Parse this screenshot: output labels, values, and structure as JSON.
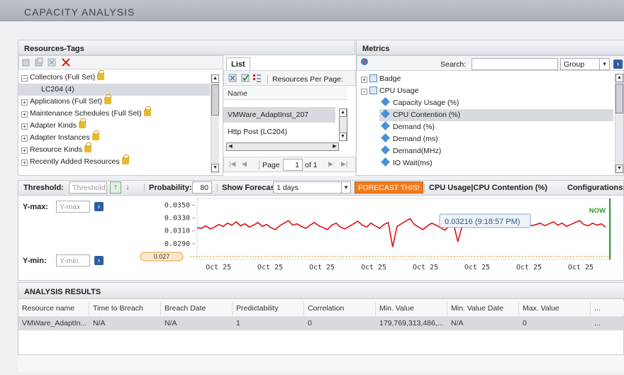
{
  "app": {
    "title": "CAPACITY ANALYSIS"
  },
  "resources": {
    "header": "Resources-Tags",
    "tree": [
      {
        "label": "Collectors (Full Set)",
        "expand": "minus",
        "lock": true,
        "indent": 0
      },
      {
        "label": "LC204 (4)",
        "expand": "",
        "lock": false,
        "indent": 1,
        "selected": true
      },
      {
        "label": "Applications (Full Set)",
        "expand": "plus",
        "lock": true,
        "indent": 0
      },
      {
        "label": "Maintenance Schedules (Full Set)",
        "expand": "plus",
        "lock": true,
        "indent": 0
      },
      {
        "label": "Adapter Kinds",
        "expand": "plus",
        "lock": true,
        "indent": 0
      },
      {
        "label": "Adapter Instances",
        "expand": "plus",
        "lock": true,
        "indent": 0
      },
      {
        "label": "Resource Kinds",
        "expand": "plus",
        "lock": true,
        "indent": 0
      },
      {
        "label": "Recently Added Resources",
        "expand": "plus",
        "lock": true,
        "indent": 0
      }
    ]
  },
  "list": {
    "tab": "List",
    "resources_per_page": "Resources Per Page:",
    "column": "Name",
    "rows": [
      "VMWare_AdaptInst_207",
      "Http Post (LC204)"
    ],
    "page_label": "Page",
    "page_value": "1",
    "of_label": "of 1"
  },
  "metrics": {
    "header": "Metrics",
    "search_label": "Search:",
    "search_value": "",
    "group_value": "Group",
    "items": [
      {
        "label": "Badge",
        "type": "group",
        "expand": "plus",
        "indent": 0
      },
      {
        "label": "CPU Usage",
        "type": "group",
        "expand": "minus",
        "indent": 0
      },
      {
        "label": "Capacity Usage (%)",
        "type": "metric",
        "indent": 1
      },
      {
        "label": "CPU Contention (%)",
        "type": "metric",
        "indent": 1,
        "selected": true
      },
      {
        "label": "Demand (%)",
        "type": "metric",
        "indent": 1
      },
      {
        "label": "Demand (ms)",
        "type": "metric",
        "indent": 1
      },
      {
        "label": "Demand(MHz)",
        "type": "metric",
        "indent": 1
      },
      {
        "label": "IO Wait(ms)",
        "type": "metric",
        "indent": 1
      }
    ]
  },
  "toolbar": {
    "threshold_label": "Threshold:",
    "threshold_placeholder": "Threshold",
    "probability_label": "Probability:",
    "probability_value": "80",
    "forecast_label": "Show Forecast:",
    "forecast_value": "1 days",
    "forecast_button": "FORECAST THIS!",
    "metric_title": "CPU Usage|CPU Contention (%)",
    "configurations": "Configurations:"
  },
  "chart_controls": {
    "ymax_label": "Y-max:",
    "ymax_placeholder": "Y-max",
    "ymin_label": "Y-min:",
    "ymin_placeholder": "Y-min",
    "threshold_badge": "0.027"
  },
  "chart_data": {
    "type": "line",
    "y_ticks": [
      "0.0350",
      "0.0330",
      "0.0310",
      "0.0290"
    ],
    "x_ticks": [
      "Oct 25",
      "Oct 25",
      "Oct 25",
      "Oct 25",
      "Oct 25",
      "Oct 25",
      "Oct 25",
      "Oct 25"
    ],
    "ylim": [
      0.027,
      0.0356
    ],
    "tooltip": "0.03216 (9:18:57 PM)",
    "now_label": "NOW",
    "threshold_line": 0.027,
    "colors": {
      "series": "#e01010",
      "now": "#2a9a2a",
      "threshold": "#e8a030"
    },
    "series": [
      {
        "values": [
          0.0315,
          0.0314,
          0.0318,
          0.0313,
          0.0316,
          0.032,
          0.0317,
          0.0322,
          0.0319,
          0.0324,
          0.0318,
          0.0321,
          0.0316,
          0.0319,
          0.0323,
          0.0317,
          0.032,
          0.0315,
          0.0312,
          0.0318,
          0.0322,
          0.0326,
          0.0319,
          0.0321,
          0.0317,
          0.0314,
          0.0319,
          0.0323,
          0.0318,
          0.0315,
          0.0312,
          0.0319,
          0.0322,
          0.0316,
          0.0313,
          0.0317,
          0.0321,
          0.0325,
          0.0319,
          0.0316,
          0.0322,
          0.0318,
          0.0314,
          0.032,
          0.0323,
          0.0285,
          0.0317,
          0.0321,
          0.0325,
          0.0329,
          0.032,
          0.0316,
          0.0312,
          0.0318,
          0.0322,
          0.0319,
          0.0315,
          0.0311,
          0.0317,
          0.0322,
          0.0293,
          0.0318,
          0.0321,
          0.0325,
          0.0319,
          0.0323,
          0.0327,
          0.0321,
          0.0318,
          0.0322,
          0.0333,
          0.032,
          0.0317,
          0.0321,
          0.0325,
          0.0319,
          0.0322,
          0.0318,
          0.032,
          0.0322,
          0.0318,
          0.0321,
          0.0324,
          0.0319,
          0.0322,
          0.0317,
          0.032,
          0.0323,
          0.0326,
          0.032,
          0.0318,
          0.0322,
          0.0319,
          0.0321,
          0.0316
        ]
      }
    ]
  },
  "results": {
    "header": "ANALYSIS RESULTS",
    "columns": [
      "Resource name",
      "Time to Breach",
      "Breach Date",
      "Predictability",
      "Correlation",
      "Min. Value",
      "Min. Value Date",
      "Max. Value",
      "..."
    ],
    "row": [
      "VMWare_AdaptIn...",
      "N/A",
      "N/A",
      "1",
      "0",
      "179,769,313,486,...",
      "N/A",
      "0",
      "..."
    ]
  }
}
